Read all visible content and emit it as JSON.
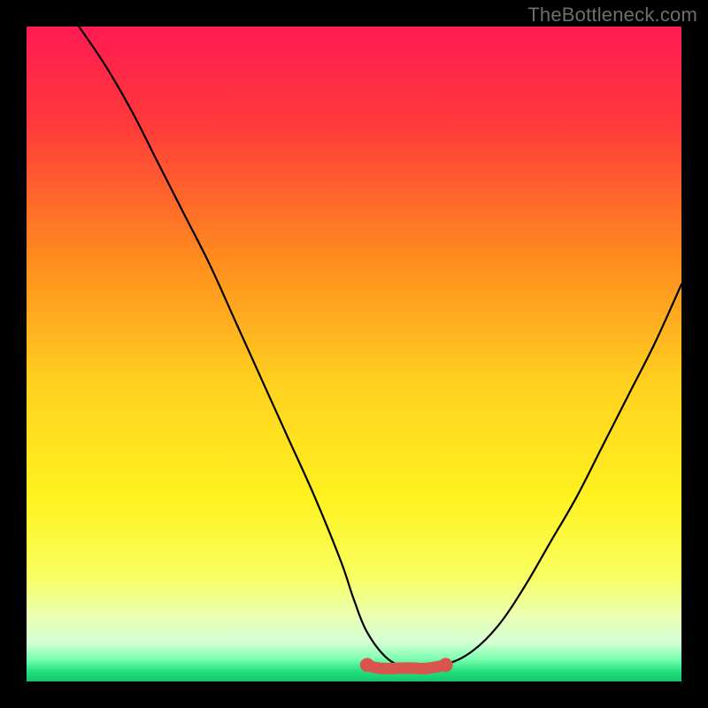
{
  "watermark": "TheBottleneck.com",
  "colors": {
    "background": "#000000",
    "gradient_stops": [
      {
        "offset": 0.0,
        "color": "#ff1a52"
      },
      {
        "offset": 0.15,
        "color": "#ff3a3a"
      },
      {
        "offset": 0.35,
        "color": "#ff8a1f"
      },
      {
        "offset": 0.55,
        "color": "#ffd21f"
      },
      {
        "offset": 0.72,
        "color": "#fff21f"
      },
      {
        "offset": 0.84,
        "color": "#f8ff60"
      },
      {
        "offset": 0.9,
        "color": "#eaffb3"
      },
      {
        "offset": 0.94,
        "color": "#d4ffd4"
      },
      {
        "offset": 0.965,
        "color": "#7fffb0"
      },
      {
        "offset": 0.985,
        "color": "#1fe07f"
      },
      {
        "offset": 1.0,
        "color": "#18c46b"
      }
    ],
    "curve": "#000000",
    "valley_highlight": "#d9544d"
  },
  "chart_data": {
    "type": "line",
    "title": "",
    "xlabel": "",
    "ylabel": "",
    "xlim": [
      0,
      100
    ],
    "ylim": [
      0,
      100
    ],
    "grid": false,
    "legend": false,
    "annotations": [
      {
        "text": "TheBottleneck.com",
        "role": "watermark",
        "pos": "top-right"
      }
    ],
    "series": [
      {
        "name": "bottleneck_curve",
        "x": [
          8,
          12,
          16,
          20,
          24,
          28,
          32,
          36,
          40,
          44,
          48,
          50,
          52,
          55,
          58,
          60,
          64,
          68,
          72,
          76,
          80,
          84,
          88,
          92,
          96,
          100
        ],
        "y": [
          100,
          94,
          87,
          79,
          71,
          63,
          54,
          45,
          36,
          27,
          17,
          11,
          6,
          2,
          0.5,
          0.5,
          1,
          3,
          7,
          13,
          20,
          27,
          35,
          43,
          51,
          60
        ]
      }
    ],
    "valley_highlight": {
      "x_range": [
        52,
        64
      ],
      "y": 0.5
    }
  }
}
